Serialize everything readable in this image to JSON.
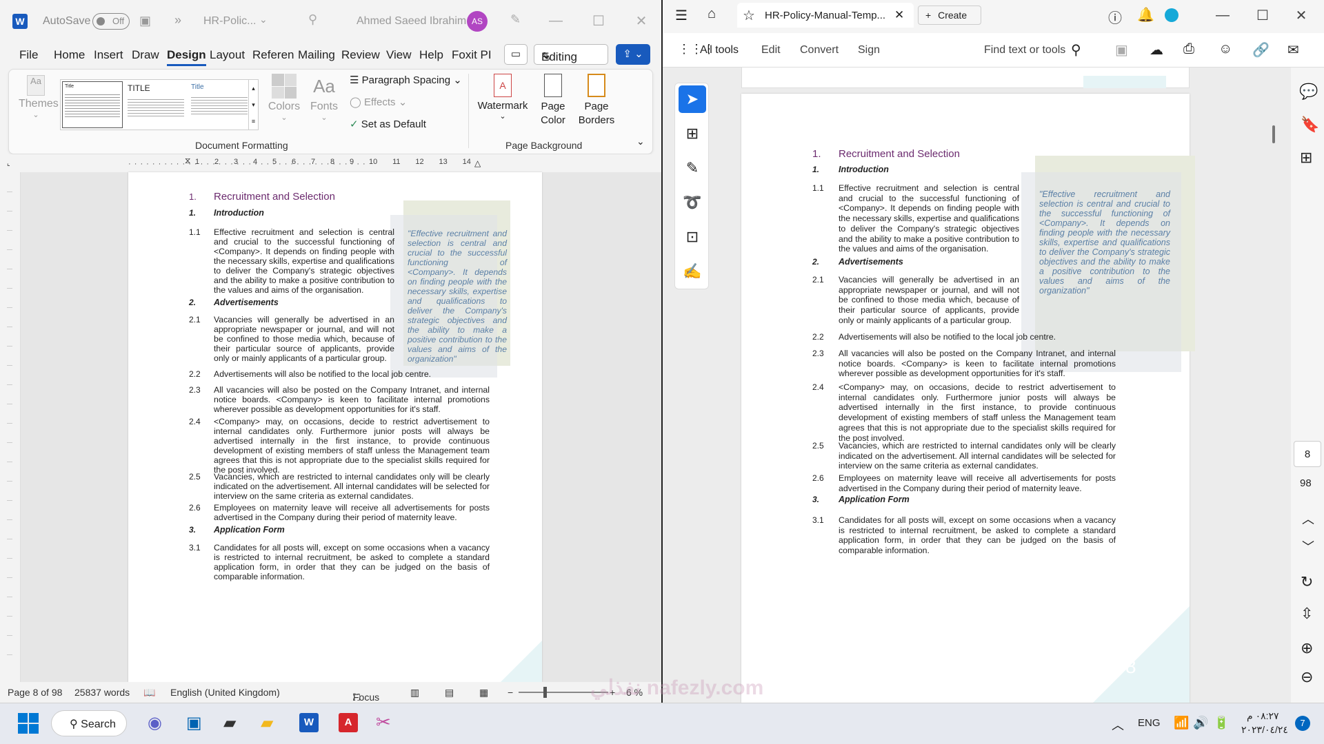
{
  "word": {
    "title_bar": {
      "autosave_label": "AutoSave",
      "autosave_state": "Off",
      "doc_name": "HR-Polic...",
      "user_name": "Ahmed Saeed Ibrahim",
      "user_initials": "AS"
    },
    "menu": [
      "File",
      "Home",
      "Insert",
      "Draw",
      "Design",
      "Layout",
      "Referen",
      "Mailing",
      "Review",
      "View",
      "Help",
      "Foxit PI"
    ],
    "editing_label": "Editing",
    "ribbon": {
      "themes": "Themes",
      "style_gallery": [
        "Title",
        "TITLE",
        "Title"
      ],
      "colors": "Colors",
      "fonts": "Fonts",
      "paragraph_spacing": "Paragraph Spacing",
      "effects": "Effects",
      "set_as_default": "Set as Default",
      "watermark": "Watermark",
      "page_color": "Page Color",
      "page_borders": "Page Borders",
      "group_document_formatting": "Document Formatting",
      "group_page_background": "Page Background"
    },
    "ruler_numbers": [
      "1",
      "2",
      "3",
      "4",
      "5",
      "6",
      "7",
      "8",
      "9",
      "10",
      "11",
      "12",
      "13",
      "14"
    ],
    "status": {
      "page": "Page 8 of 98",
      "words": "25837 words",
      "language": "English (United Kingdom)",
      "focus": "Focus",
      "zoom": "6 %"
    }
  },
  "document": {
    "section1_num": "1.",
    "section1_title": "Recruitment and Selection",
    "intro_num": "1.",
    "intro_title": "Introduction",
    "p1_1_num": "1.1",
    "p1_1": "Effective recruitment and selection is central and crucial to the successful functioning of <Company>. It depends on finding people with the necessary skills, expertise and qualifications to deliver the Company's strategic objectives and the ability to make a positive contribution to the values and aims of the organisation.",
    "adv_num": "2.",
    "adv_title": "Advertisements",
    "p2_1_num": "2.1",
    "p2_1": "Vacancies will generally be advertised in an appropriate newspaper or journal, and will not be confined to those media which, because of their particular source of applicants, provide only or mainly applicants of a particular group.",
    "p2_2_num": "2.2",
    "p2_2": "Advertisements will also be notified to the local job centre.",
    "p2_3_num": "2.3",
    "p2_3_word": "All vacancies will also be posted on the Company Intranet, and internal notice boards. <Company> is keen to facilitate internal promotions wherever possible as development opportunities for it's staff.",
    "p2_3_pdf": "All vacancies will also be posted on the Company Intranet, and internal notice boards. <Company> is keen to facilitate internal promotions wherever possible as development opportunities for it's staff.",
    "p2_4_num": "2.4",
    "p2_4": "<Company> may, on occasions, decide to restrict advertisement to internal candidates only. Furthermore junior posts will always be advertised internally in the first instance, to provide continuous development of existing members of staff unless the Management team agrees that this is not appropriate due to the specialist skills required for the post involved.",
    "p2_5_num": "2.5",
    "p2_5": "Vacancies, which are restricted to internal candidates only will be clearly indicated on the advertisement. All internal candidates will be selected for interview on the same criteria as external candidates.",
    "p2_6_num": "2.6",
    "p2_6": "Employees on maternity leave will receive all advertisements for posts advertised in the Company during their period of maternity leave.",
    "app_num": "3.",
    "app_title": "Application Form",
    "p3_1_num": "3.1",
    "p3_1": "Candidates for all posts will, except on some occasions when a vacancy is restricted to internal recruitment, be asked to complete a standard application form, in order that they can be judged on the basis of comparable information.",
    "quote": "\"Effective recruitment and selection is central and crucial to the successful functioning of <Company>. It depends on finding people with the necessary skills, expertise and qualifications to deliver the Company's strategic objectives and the ability to make a positive contribution to the values and aims of the organization\"",
    "page_number": "8"
  },
  "acrobat": {
    "tab_title": "HR-Policy-Manual-Temp...",
    "create": "Create",
    "tools": [
      "All tools",
      "Edit",
      "Convert",
      "Sign"
    ],
    "find": "Find text or tools",
    "page_current": "8",
    "page_total": "98"
  },
  "taskbar": {
    "search": "Search",
    "lang": "ENG",
    "time": "٠٨:٢٧ م",
    "date": "٢٠٢٣/٠٤/٢٤",
    "badge": "7",
    "watermark": "نفذلي nafezly.com"
  },
  "colors": {
    "heading": "#6b2a6e",
    "quote": "#5a7fa6",
    "accent": "#1a73e8"
  }
}
